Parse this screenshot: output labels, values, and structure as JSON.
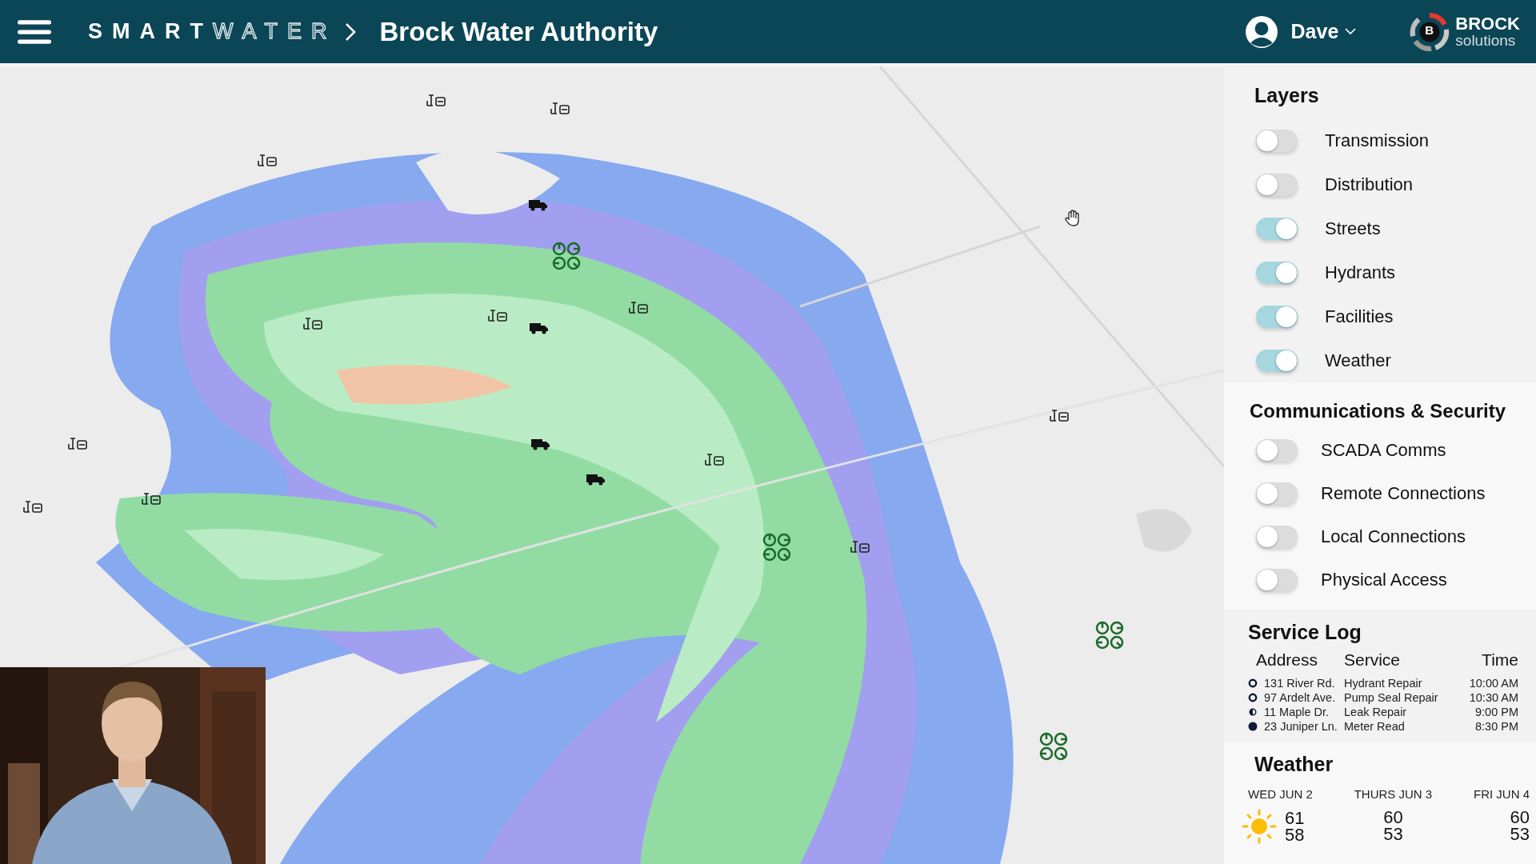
{
  "header": {
    "brand_bold": "SMART",
    "brand_outline": "WATER",
    "title": "Brock Water Authority",
    "user": "Dave",
    "logo_top": "BROCK",
    "logo_bottom": "solutions",
    "logo_letter": "B"
  },
  "layers": {
    "title": "Layers",
    "items": [
      {
        "label": "Transmission",
        "on": false
      },
      {
        "label": "Distribution",
        "on": false
      },
      {
        "label": "Streets",
        "on": true
      },
      {
        "label": "Hydrants",
        "on": true
      },
      {
        "label": "Facilities",
        "on": true
      },
      {
        "label": "Weather",
        "on": true
      }
    ]
  },
  "communications": {
    "title": "Communications & Security",
    "items": [
      {
        "label": "SCADA Comms",
        "on": false
      },
      {
        "label": "Remote Connections",
        "on": false
      },
      {
        "label": "Local Connections",
        "on": false
      },
      {
        "label": "Physical Access",
        "on": false
      }
    ]
  },
  "service_log": {
    "title": "Service Log",
    "columns": [
      "Address",
      "Service",
      "Time"
    ],
    "rows": [
      {
        "kind": "empty",
        "address": "131 River Rd.",
        "service": "Hydrant Repair",
        "time": "10:00 AM"
      },
      {
        "kind": "empty",
        "address": "97 Ardelt Ave.",
        "service": "Pump Seal Repair",
        "time": "10:30 AM"
      },
      {
        "kind": "half",
        "address": "11 Maple Dr.",
        "service": "Leak Repair",
        "time": "9:00 PM"
      },
      {
        "kind": "full",
        "address": "23 Juniper Ln.",
        "service": "Meter Read",
        "time": "8:30 PM"
      }
    ]
  },
  "weather": {
    "title": "Weather",
    "days": [
      {
        "kind": "sun",
        "day": "WED JUN 2",
        "high": "61",
        "low": "58"
      },
      {
        "kind": "blank",
        "day": "THURS JUN 3",
        "high": "60",
        "low": "53"
      },
      {
        "kind": "blank",
        "day": "FRI JUN 4",
        "high": "60",
        "low": "53"
      }
    ]
  }
}
